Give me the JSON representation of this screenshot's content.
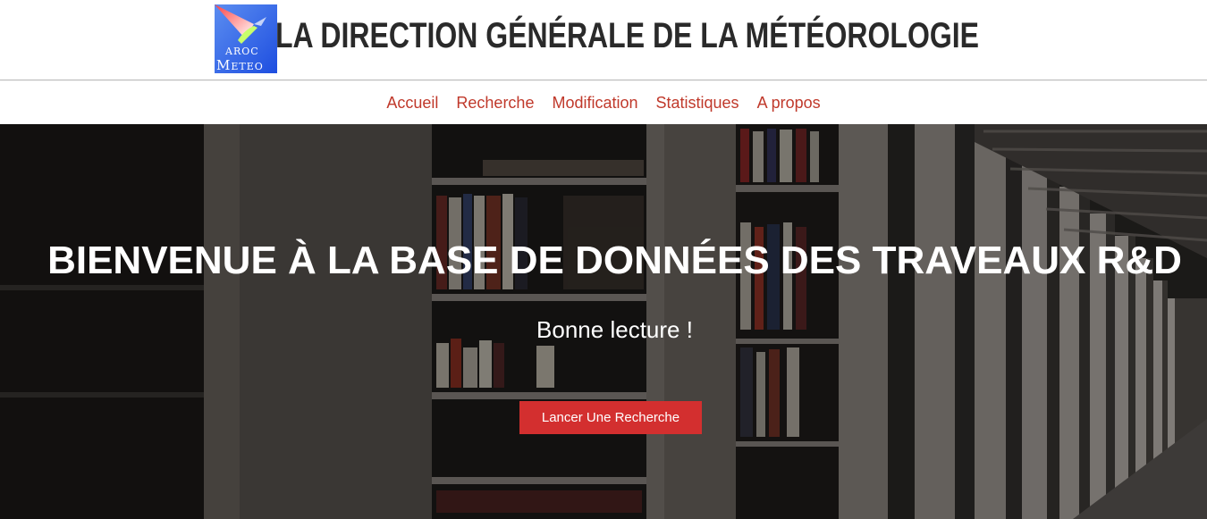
{
  "header": {
    "logo_line1": "AROC",
    "logo_line2_initial": "M",
    "logo_line2_rest": "ETEO",
    "title": "LA DIRECTION GÉNÉRALE DE LA MÉTÉOROLOGIE"
  },
  "nav": {
    "items": [
      {
        "label": "Accueil"
      },
      {
        "label": "Recherche"
      },
      {
        "label": "Modification"
      },
      {
        "label": "Statistiques"
      },
      {
        "label": "A propos"
      }
    ]
  },
  "hero": {
    "title": "BIENVENUE À LA BASE DE DONNÉES DES TRAVEAUX R&D",
    "subtitle": "Bonne lecture !",
    "button_label": "Lancer Une Recherche"
  },
  "colors": {
    "accent": "#d32f2f",
    "nav_link": "#c0392b",
    "title_text": "#2a2a2a"
  }
}
